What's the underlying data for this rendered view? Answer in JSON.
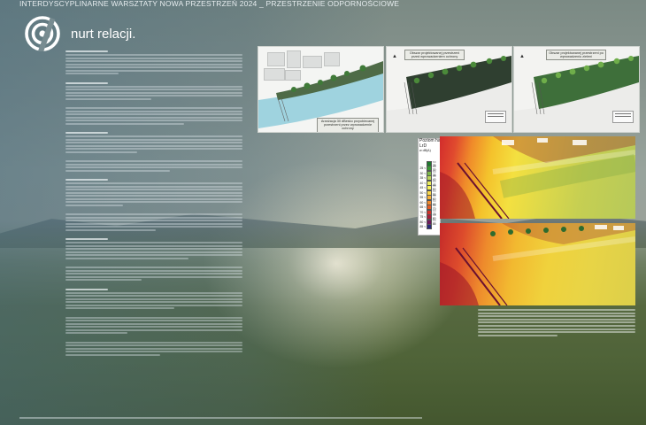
{
  "poster": {
    "top_title": "INTERDYSCYPLINARNE WARSZTATY NOWA PRZESTRZEŃ 2024 _ PRZESTRZENIE ODPORNOŚCIOWE",
    "logo_text": "nurt relacji."
  },
  "maps": [
    {
      "label": "Aranżacja 30 dBesko przyobiecanej przestrzeni przez wprowadzenie ochrony"
    },
    {
      "label": "Obszar projektowanej przestrzeni przed wprowadzeniem ochrony"
    },
    {
      "label": "Obszar projektowanej przestrzeni po wprowadzeniu zieleni"
    }
  ],
  "noise_legend": {
    "title_line1": "Poziom hałasu",
    "title_line2": "LrD",
    "unit": "w dB(A)",
    "rows": [
      {
        "from": "",
        "to": "<= 25",
        "color": "#1e7b2e"
      },
      {
        "from": "25 <",
        "to": "<= 30",
        "color": "#3b9a37"
      },
      {
        "from": "30 <",
        "to": "<= 35",
        "color": "#7cb84a"
      },
      {
        "from": "35 <",
        "to": "<= 40",
        "color": "#b9d35a"
      },
      {
        "from": "40 <",
        "to": "<= 45",
        "color": "#e9ec5c"
      },
      {
        "from": "45 <",
        "to": "<= 50",
        "color": "#f7f159"
      },
      {
        "from": "50 <",
        "to": "<= 55",
        "color": "#f9d84a"
      },
      {
        "from": "55 <",
        "to": "<= 60",
        "color": "#f6b23a"
      },
      {
        "from": "60 <",
        "to": "<= 65",
        "color": "#ef8a2d"
      },
      {
        "from": "65 <",
        "to": "<= 70",
        "color": "#e45d28"
      },
      {
        "from": "70 <",
        "to": "<= 75",
        "color": "#d03228"
      },
      {
        "from": "75 <",
        "to": "<= 80",
        "color": "#a81f3b"
      },
      {
        "from": "80 <",
        "to": "<= 85",
        "color": "#6f1a5c"
      },
      {
        "from": "85 <",
        "to": "",
        "color": "#2a2a7a"
      }
    ]
  }
}
